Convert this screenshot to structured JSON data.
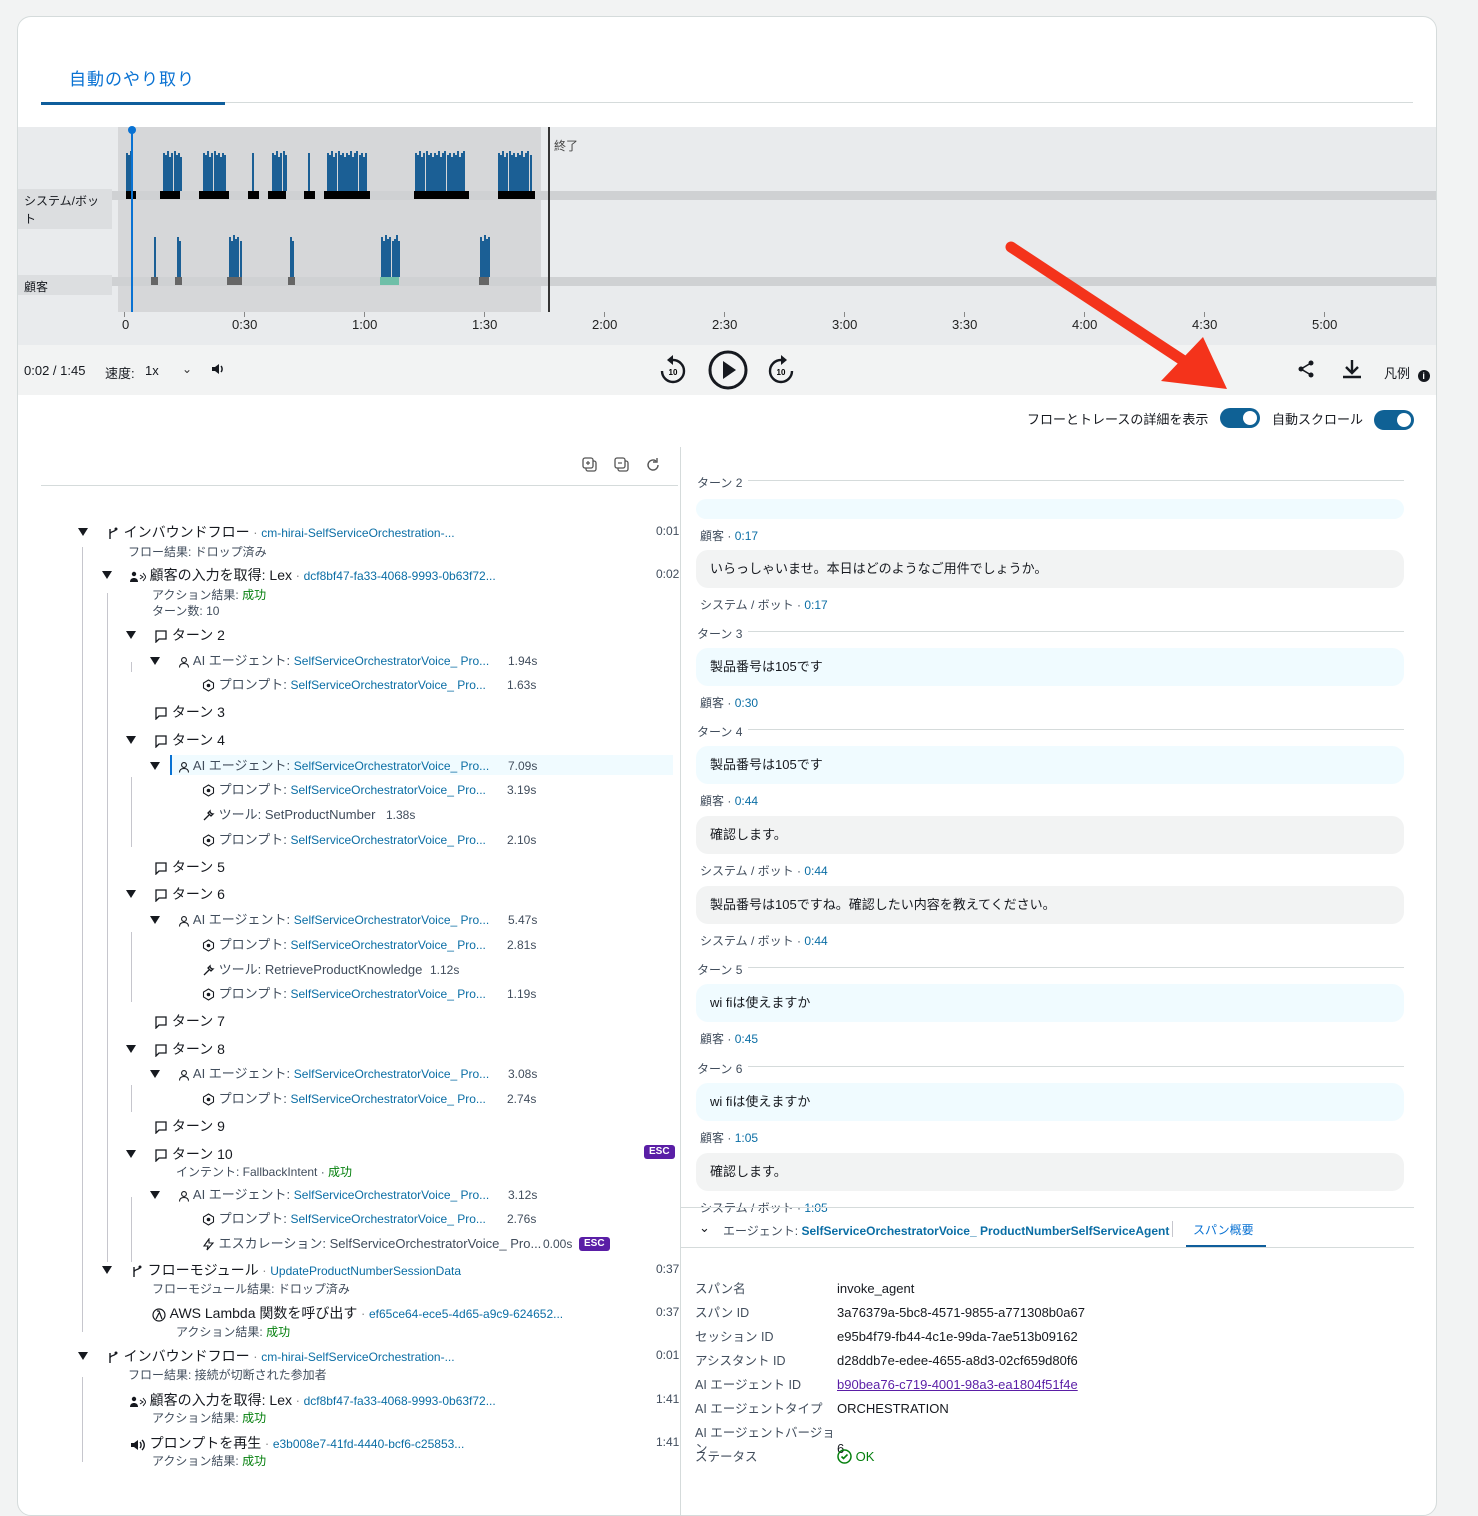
{
  "tab": {
    "label": "自動のやり取り"
  },
  "timeline": {
    "lanes": {
      "bot": "システム/ボット",
      "customer": "顧客"
    },
    "end_label": "終了",
    "ticks": [
      "0",
      "0:30",
      "1:00",
      "1:30",
      "2:00",
      "2:30",
      "3:00",
      "3:30",
      "4:00",
      "4:30",
      "5:00"
    ]
  },
  "controls": {
    "time": "0:02 / 1:45",
    "speed_label": "速度:",
    "speed_value": "1x",
    "legend": "凡例",
    "rewind_label": "10",
    "forward_label": "10"
  },
  "toggles": {
    "flow_details": "フローとトレースの詳細を表示",
    "auto_scroll": "自動スクロール"
  },
  "tree": [
    {
      "id": "r1",
      "title": "インバウンドフロー",
      "link": "cm-hirai-SelfServiceOrchestration-...",
      "sub": "フロー結果: ドロップ済み",
      "dur": "0:01"
    },
    {
      "id": "r2",
      "title": "顧客の入力を取得: Lex",
      "link": "dcf8bf47-fa33-4068-9993-0b63f72...",
      "sub1_key": "アクション結果: ",
      "sub1_val": "成功",
      "sub2": "ターン数: 10",
      "dur": "0:02"
    },
    {
      "id": "t2",
      "label": "ターン 2"
    },
    {
      "id": "t2a",
      "kind": "AI エージェント: ",
      "link": "SelfServiceOrchestratorVoice_ Pro...",
      "dur": "1.94s"
    },
    {
      "id": "t2b",
      "kind": "プロンプト: ",
      "link": "SelfServiceOrchestratorVoice_ Pro...",
      "dur": "1.63s"
    },
    {
      "id": "t3",
      "label": "ターン 3"
    },
    {
      "id": "t4",
      "label": "ターン 4"
    },
    {
      "id": "t4a",
      "kind": "AI エージェント: ",
      "link": "SelfServiceOrchestratorVoice_ Pro...",
      "dur": "7.09s"
    },
    {
      "id": "t4b",
      "kind": "プロンプト: ",
      "link": "SelfServiceOrchestratorVoice_ Pro...",
      "dur": "3.19s"
    },
    {
      "id": "t4c",
      "kind": "ツール: ",
      "name": "SetProductNumber",
      "dur": "1.38s"
    },
    {
      "id": "t4d",
      "kind": "プロンプト: ",
      "link": "SelfServiceOrchestratorVoice_ Pro...",
      "dur": "2.10s"
    },
    {
      "id": "t5",
      "label": "ターン 5"
    },
    {
      "id": "t6",
      "label": "ターン 6"
    },
    {
      "id": "t6a",
      "kind": "AI エージェント: ",
      "link": "SelfServiceOrchestratorVoice_ Pro...",
      "dur": "5.47s"
    },
    {
      "id": "t6b",
      "kind": "プロンプト: ",
      "link": "SelfServiceOrchestratorVoice_ Pro...",
      "dur": "2.81s"
    },
    {
      "id": "t6c",
      "kind": "ツール: ",
      "name": "RetrieveProductKnowledge",
      "dur": "1.12s"
    },
    {
      "id": "t6d",
      "kind": "プロンプト: ",
      "link": "SelfServiceOrchestratorVoice_ Pro...",
      "dur": "1.19s"
    },
    {
      "id": "t7",
      "label": "ターン 7"
    },
    {
      "id": "t8",
      "label": "ターン 8"
    },
    {
      "id": "t8a",
      "kind": "AI エージェント: ",
      "link": "SelfServiceOrchestratorVoice_ Pro...",
      "dur": "3.08s"
    },
    {
      "id": "t8b",
      "kind": "プロンプト: ",
      "link": "SelfServiceOrchestratorVoice_ Pro...",
      "dur": "2.74s"
    },
    {
      "id": "t9",
      "label": "ターン 9"
    },
    {
      "id": "t10",
      "label": "ターン 10",
      "badge": "ESC",
      "intent_key": "インテント: FallbackIntent · ",
      "intent_val": "成功"
    },
    {
      "id": "t10a",
      "kind": "AI エージェント: ",
      "link": "SelfServiceOrchestratorVoice_ Pro...",
      "dur": "3.12s"
    },
    {
      "id": "t10b",
      "kind": "プロンプト: ",
      "link": "SelfServiceOrchestratorVoice_ Pro...",
      "dur": "2.76s"
    },
    {
      "id": "t10c",
      "kind": "エスカレーション: ",
      "name": "SelfServiceOrchestratorVoice_ Pro...",
      "dur": "0.00s",
      "badge": "ESC"
    },
    {
      "id": "fm",
      "title": "フローモジュール",
      "link": "UpdateProductNumberSessionData",
      "sub": "フローモジュール結果: ドロップ済み",
      "dur": "0:37"
    },
    {
      "id": "lam",
      "title": "AWS Lambda 関数を呼び出す",
      "link": "ef65ce64-ece5-4d65-a9c9-624652...",
      "sub_key": "アクション結果: ",
      "sub_val": "成功",
      "dur": "0:37"
    },
    {
      "id": "r3",
      "title": "インバウンドフロー",
      "link": "cm-hirai-SelfServiceOrchestration-...",
      "sub": "フロー結果: 接続が切断された参加者",
      "dur": "0:01"
    },
    {
      "id": "r4",
      "title": "顧客の入力を取得: Lex",
      "link": "dcf8bf47-fa33-4068-9993-0b63f72...",
      "sub_key": "アクション結果: ",
      "sub_val": "成功",
      "dur": "1:41"
    },
    {
      "id": "r5",
      "title": "プロンプトを再生",
      "link": "e3b008e7-41fd-4440-bcf6-c25853...",
      "sub_key": "アクション結果: ",
      "sub_val": "成功",
      "dur": "1:41"
    }
  ],
  "transcript": {
    "turns": [
      "ターン 2",
      "ターン 3",
      "ターン 4",
      "ターン 5",
      "ターン 6"
    ],
    "messages": [
      {
        "text": "",
        "who": "顧客",
        "time": "0:17"
      },
      {
        "text": "いらっしゃいませ。本日はどのようなご用件でしょうか。",
        "who": "システム / ボット",
        "time": "0:17"
      },
      {
        "text": "製品番号は105です",
        "who": "顧客",
        "time": "0:30"
      },
      {
        "text": "製品番号は105です",
        "who": "顧客",
        "time": "0:44"
      },
      {
        "text": "確認します。",
        "who": "システム / ボット",
        "time": "0:44"
      },
      {
        "text": "製品番号は105ですね。確認したい内容を教えてください。",
        "who": "システム / ボット",
        "time": "0:44"
      },
      {
        "text": "wi fiは使えますか",
        "who": "顧客",
        "time": "0:45"
      },
      {
        "text": "wi fiは使えますか",
        "who": "顧客",
        "time": "1:05"
      },
      {
        "text": "確認します。",
        "who": "システム / ボット",
        "time": "1:05"
      }
    ]
  },
  "details": {
    "agent_label": "エージェント: ",
    "agent_link": "SelfServiceOrchestratorVoice_ ProductNumberSelfServiceAgent",
    "tab": "スパン概要",
    "rows": [
      {
        "k": "スパン名",
        "v": "invoke_agent"
      },
      {
        "k": "スパン ID",
        "v": "3a76379a-5bc8-4571-9855-a771308b0a67"
      },
      {
        "k": "セッション ID",
        "v": "e95b4f79-fb44-4c1e-99da-7ae513b09162"
      },
      {
        "k": "アシスタント ID",
        "v": "d28ddb7e-edee-4655-a8d3-02cf659d80f6"
      },
      {
        "k": "AI エージェント ID",
        "v": "b90bea76-c719-4001-98a3-ea1804f51f4e"
      },
      {
        "k": "AI エージェントタイプ",
        "v": "ORCHESTRATION"
      },
      {
        "k": "AI エージェントバージョン",
        "v": "6"
      },
      {
        "k": "ステータス",
        "v": "OK"
      }
    ]
  },
  "colors": {
    "accent": "#0972d3",
    "bar": "#1b5f95",
    "toggle": "#0f6195",
    "esc": "#5a1ea6",
    "success": "#037f0c",
    "arrow": "#f4331b"
  }
}
